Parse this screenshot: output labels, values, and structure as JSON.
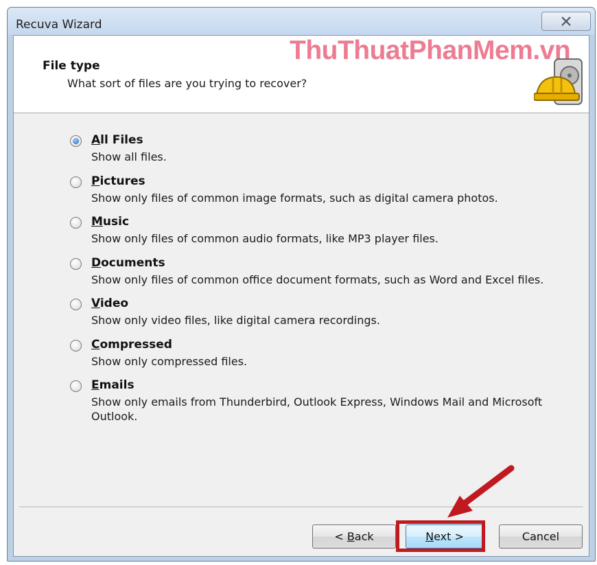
{
  "window": {
    "title": "Recuva Wizard",
    "close_symbol": "close-icon"
  },
  "header": {
    "title": "File type",
    "subtitle": "What sort of files are you trying to recover?",
    "watermark": "ThuThuatPhanMem.vn",
    "icon": "hard-drive-helmet-icon"
  },
  "options": [
    {
      "label": "All Files",
      "underline": "A",
      "rest": "ll Files",
      "description": "Show all files.",
      "checked": true
    },
    {
      "label": "Pictures",
      "underline": "P",
      "rest": "ictures",
      "description": "Show only files of common image formats, such as digital camera photos.",
      "checked": false
    },
    {
      "label": "Music",
      "underline": "M",
      "rest": "usic",
      "description": "Show only files of common audio formats, like MP3 player files.",
      "checked": false
    },
    {
      "label": "Documents",
      "underline": "D",
      "rest": "ocuments",
      "description": "Show only files of common office document formats, such as Word and Excel files.",
      "checked": false
    },
    {
      "label": "Video",
      "underline": "V",
      "rest": "ideo",
      "description": "Show only video files, like digital camera recordings.",
      "checked": false
    },
    {
      "label": "Compressed",
      "underline": "C",
      "rest": "ompressed",
      "description": "Show only compressed files.",
      "checked": false
    },
    {
      "label": "Emails",
      "underline": "E",
      "rest": "mails",
      "description": "Show only emails from Thunderbird, Outlook Express, Windows Mail and Microsoft Outlook.",
      "checked": false
    }
  ],
  "buttons": {
    "back_prefix": "< ",
    "back_underline": "B",
    "back_rest": "ack",
    "next_underline": "N",
    "next_rest": "ext >",
    "cancel": "Cancel"
  },
  "annotation": {
    "highlight_color": "#c0191f"
  }
}
